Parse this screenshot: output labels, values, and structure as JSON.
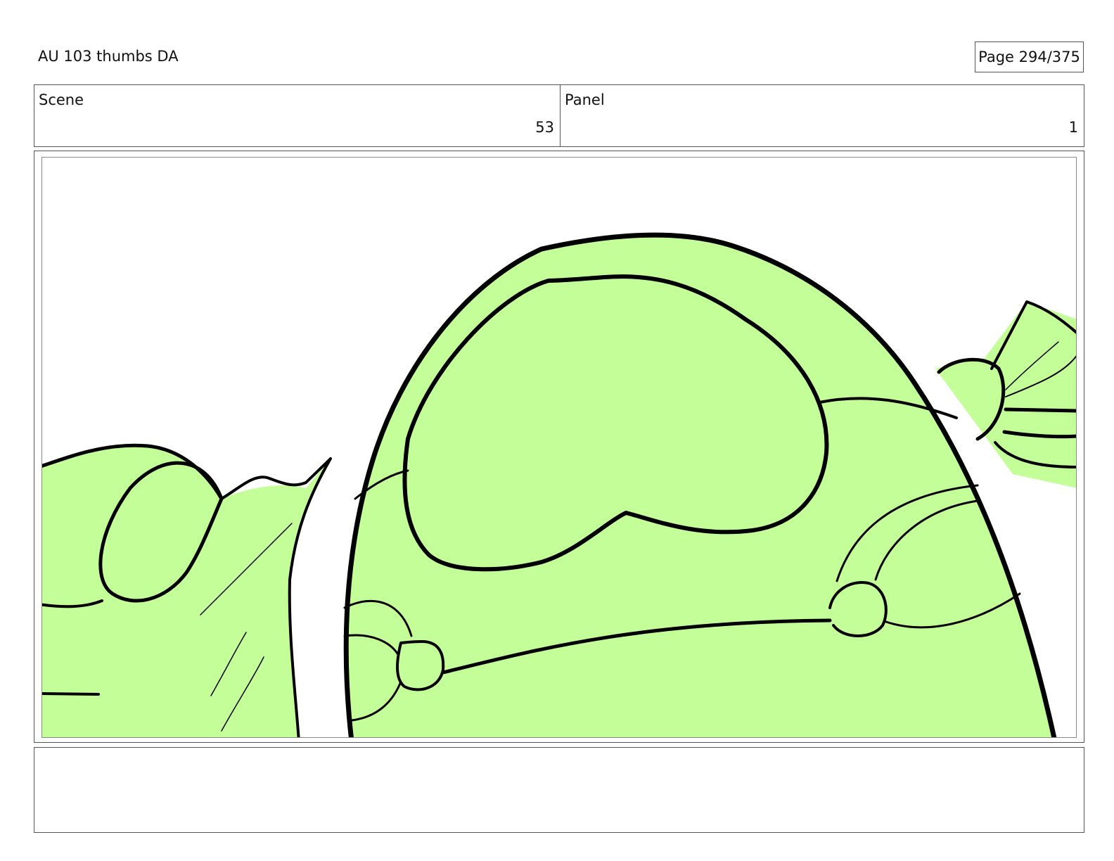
{
  "header": {
    "title": "AU 103 thumbs DA",
    "page_indicator": "Page 294/375"
  },
  "info": {
    "scene_label": "Scene",
    "scene_value": "53",
    "panel_label": "Panel",
    "panel_value": "1"
  },
  "artwork": {
    "fill_color": "#c3fe98",
    "line_color": "#000000",
    "subject": "green-character-back-drawing"
  },
  "notes": {
    "text": ""
  }
}
